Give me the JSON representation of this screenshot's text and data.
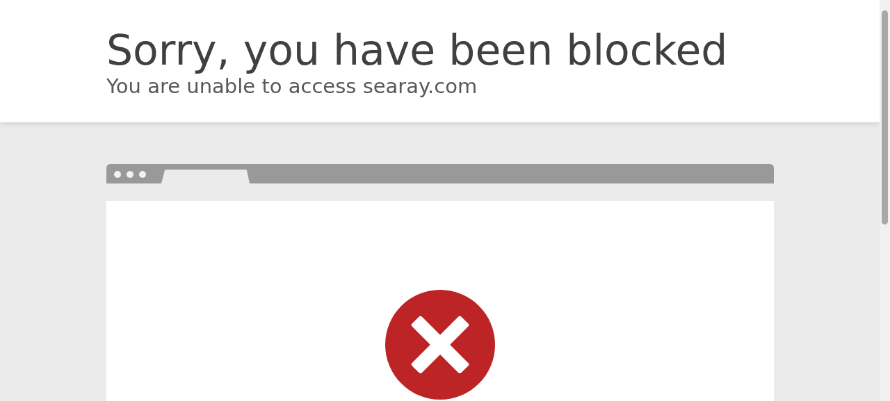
{
  "header": {
    "title": "Sorry, you have been blocked",
    "subtitle": "You are unable to access searay.com"
  }
}
